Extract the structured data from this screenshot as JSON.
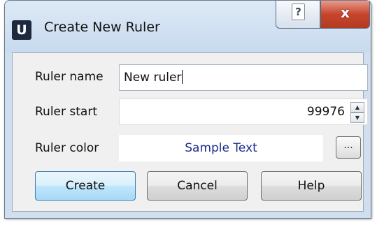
{
  "window": {
    "app_icon_letter": "U",
    "title": "Create New Ruler",
    "help_glyph": "?",
    "close_glyph": "x"
  },
  "form": {
    "name_label": "Ruler name",
    "name_value": "New ruler",
    "start_label": "Ruler start",
    "start_value": "99976",
    "color_label": "Ruler color",
    "color_sample": "Sample Text",
    "color_sample_color": "#1a2b8c",
    "color_picker_label": "..."
  },
  "buttons": {
    "create": "Create",
    "cancel": "Cancel",
    "help": "Help"
  },
  "colors": {
    "title_bar": "#c8daee",
    "close_button": "#c6452c",
    "default_button_border": "#3c7fb1",
    "client_background": "#f0f0f0"
  }
}
